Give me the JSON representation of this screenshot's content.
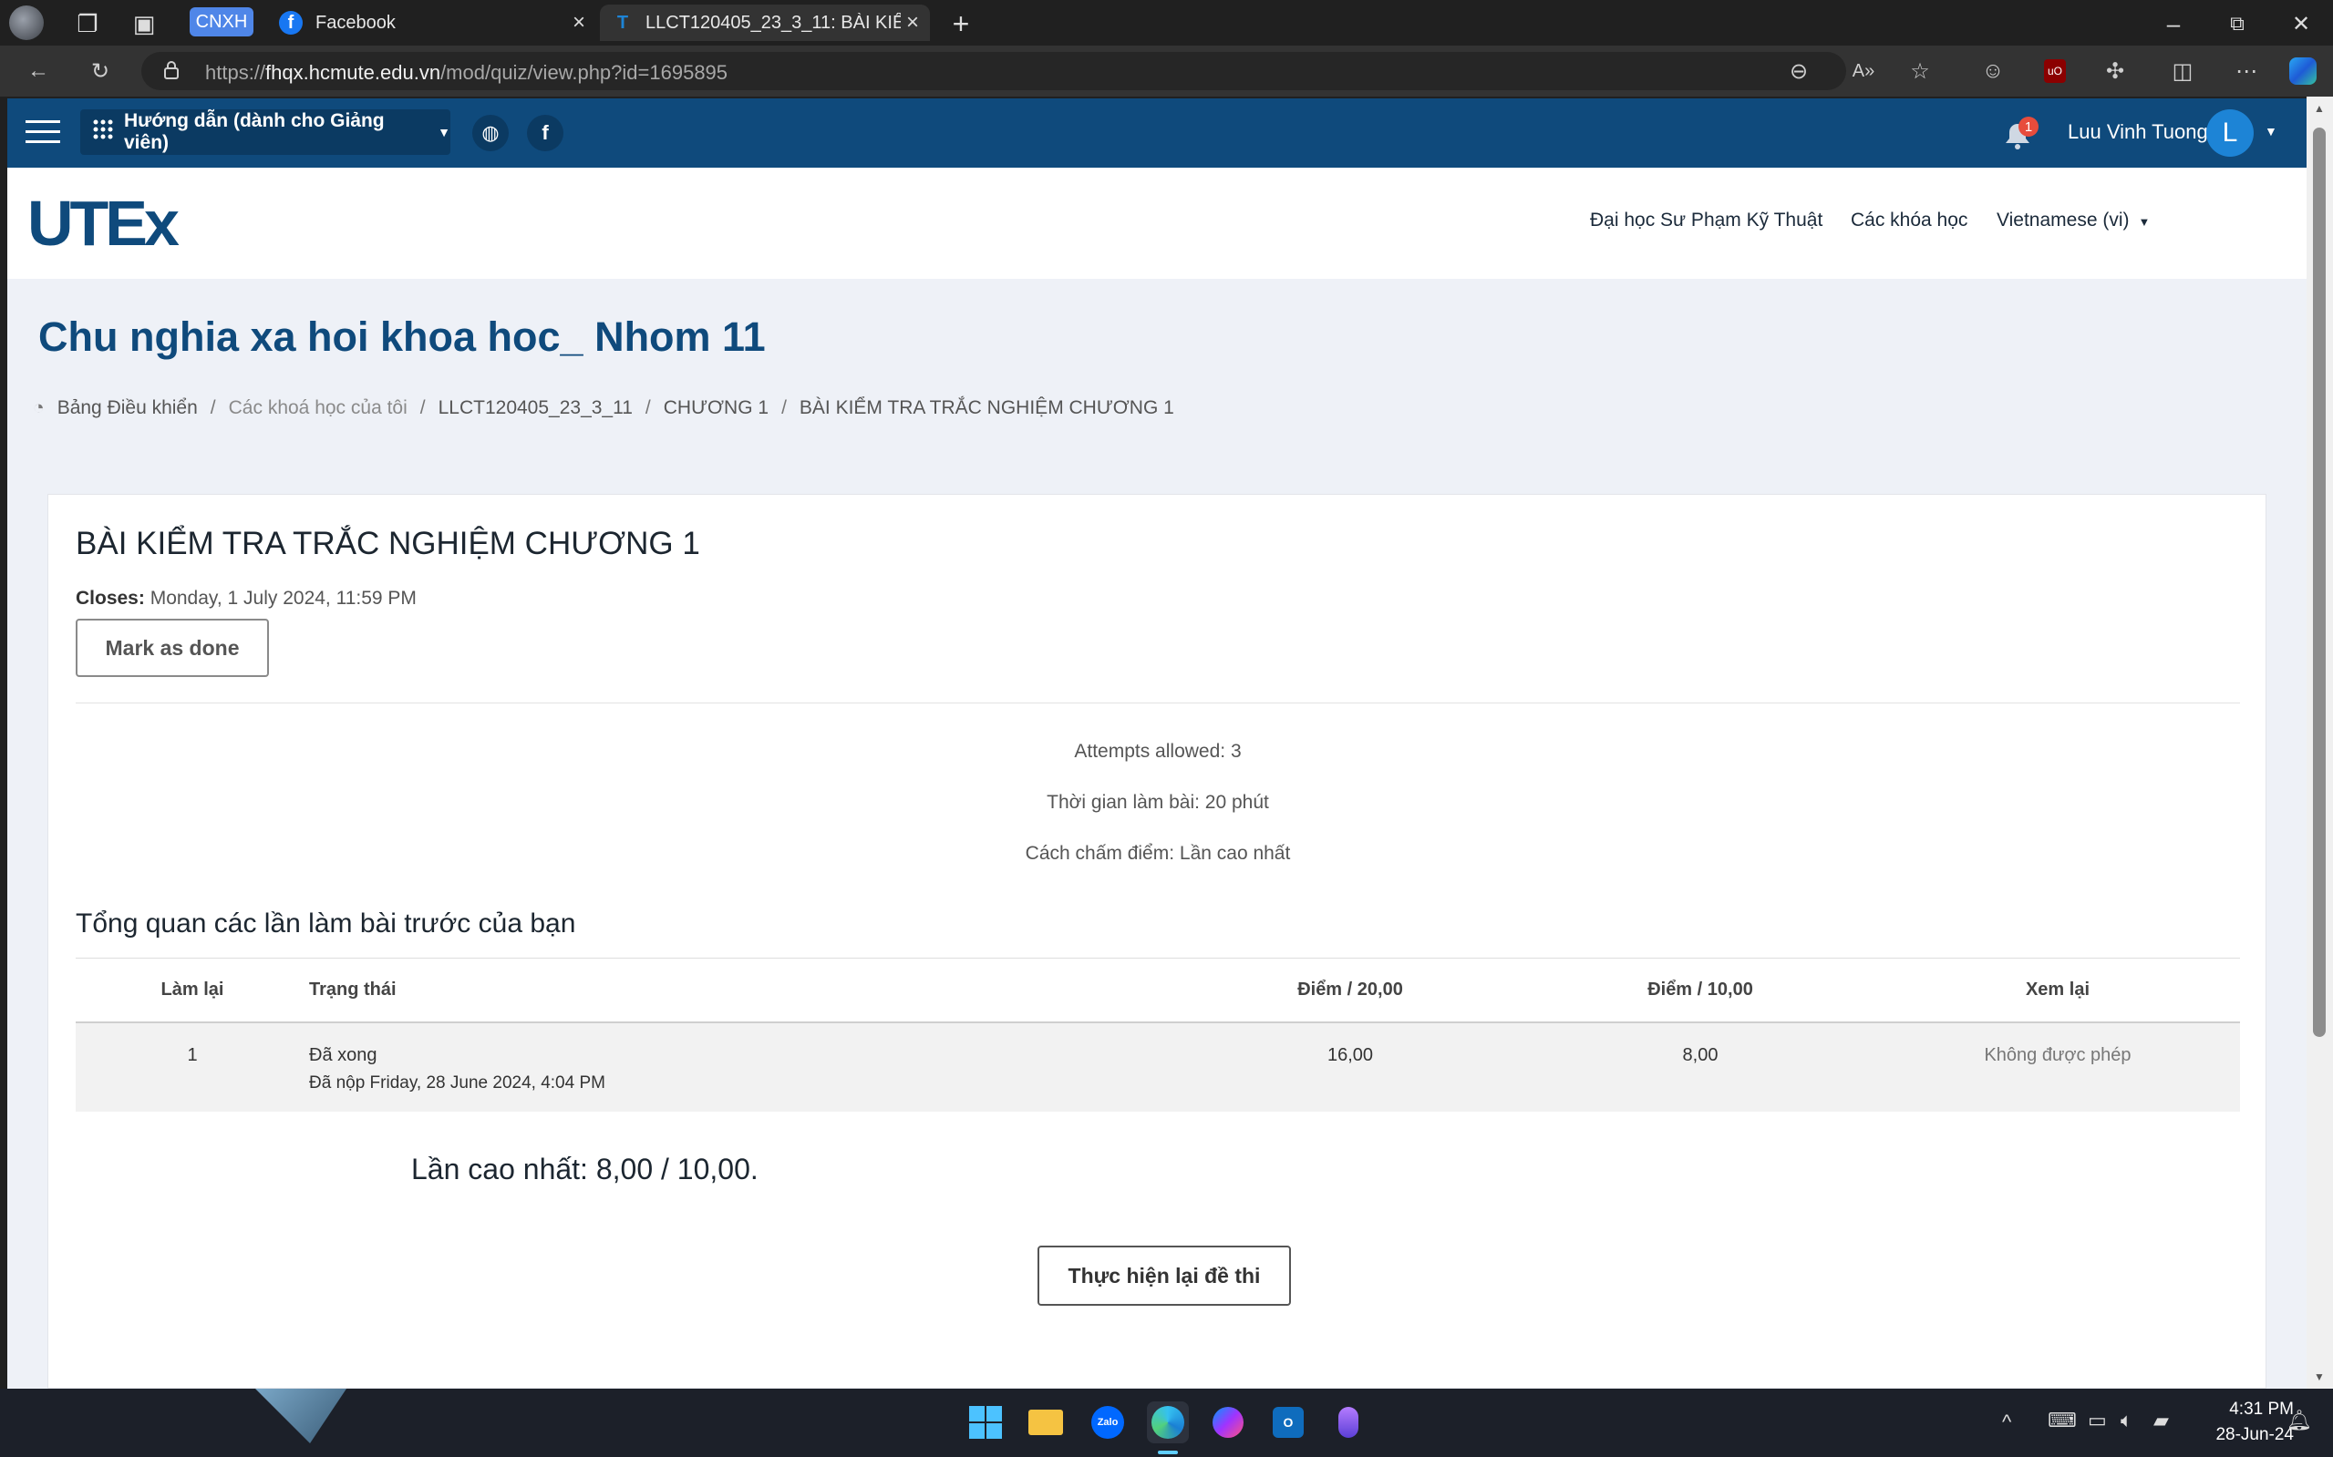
{
  "browser": {
    "tabs": [
      {
        "label": "CNXH",
        "type": "group"
      },
      {
        "label": "Facebook",
        "close": "×"
      },
      {
        "label": "LLCT120405_23_3_11: BÀI KIỂM T",
        "close": "×",
        "active": true
      }
    ],
    "new_tab": "+",
    "window_controls": {
      "minimize": "–",
      "restore": "⧉",
      "close": "✕"
    },
    "url_prefix": "https://",
    "url_host": "fhqx.hcmute.edu.vn",
    "url_path": "/mod/quiz/view.php?id=1695895"
  },
  "site_nav": {
    "guide_label": "Hướng dẫn (dành cho Giảng viên)",
    "notification_count": "1",
    "user_name": "Luu Vinh Tuong",
    "avatar_initial": "L"
  },
  "header": {
    "logo_text": "UTEx",
    "links": [
      "Đại học Sư Phạm Kỹ Thuật",
      "Các khóa học",
      "Vietnamese (vi)"
    ]
  },
  "page": {
    "course_title": "Chu nghia xa hoi khoa hoc_ Nhom 11",
    "breadcrumbs": [
      "Bảng Điều khiển",
      "Các khoá học của tôi",
      "LLCT120405_23_3_11",
      "CHƯƠNG 1",
      "BÀI KIỂM TRA TRẮC NGHIỆM CHƯƠNG 1"
    ]
  },
  "quiz": {
    "title": "BÀI KIỂM TRA TRẮC NGHIỆM CHƯƠNG 1",
    "closes_label": "Closes:",
    "closes_value": "Monday, 1 July 2024, 11:59 PM",
    "mark_done": "Mark as done",
    "attempts_allowed": "Attempts allowed: 3",
    "time_limit": "Thời gian làm bài: 20 phút",
    "grading_method": "Cách chấm điểm: Lần cao nhất",
    "overview_title": "Tổng quan các lần làm bài trước của bạn",
    "table": {
      "headers": [
        "Làm lại",
        "Trạng thái",
        "Điểm / 20,00",
        "Điểm / 10,00",
        "Xem lại"
      ],
      "rows": [
        {
          "attempt": "1",
          "status": "Đã xong",
          "submitted": "Đã nộp Friday, 28 June 2024, 4:04 PM",
          "marks": "16,00",
          "grade": "8,00",
          "review": "Không được phép"
        }
      ]
    },
    "best_grade": "Lần cao nhất: 8,00 / 10,00.",
    "retake_button": "Thực hiện lại đề thi"
  },
  "taskbar": {
    "time": "4:31 PM",
    "date": "28-Jun-24"
  }
}
